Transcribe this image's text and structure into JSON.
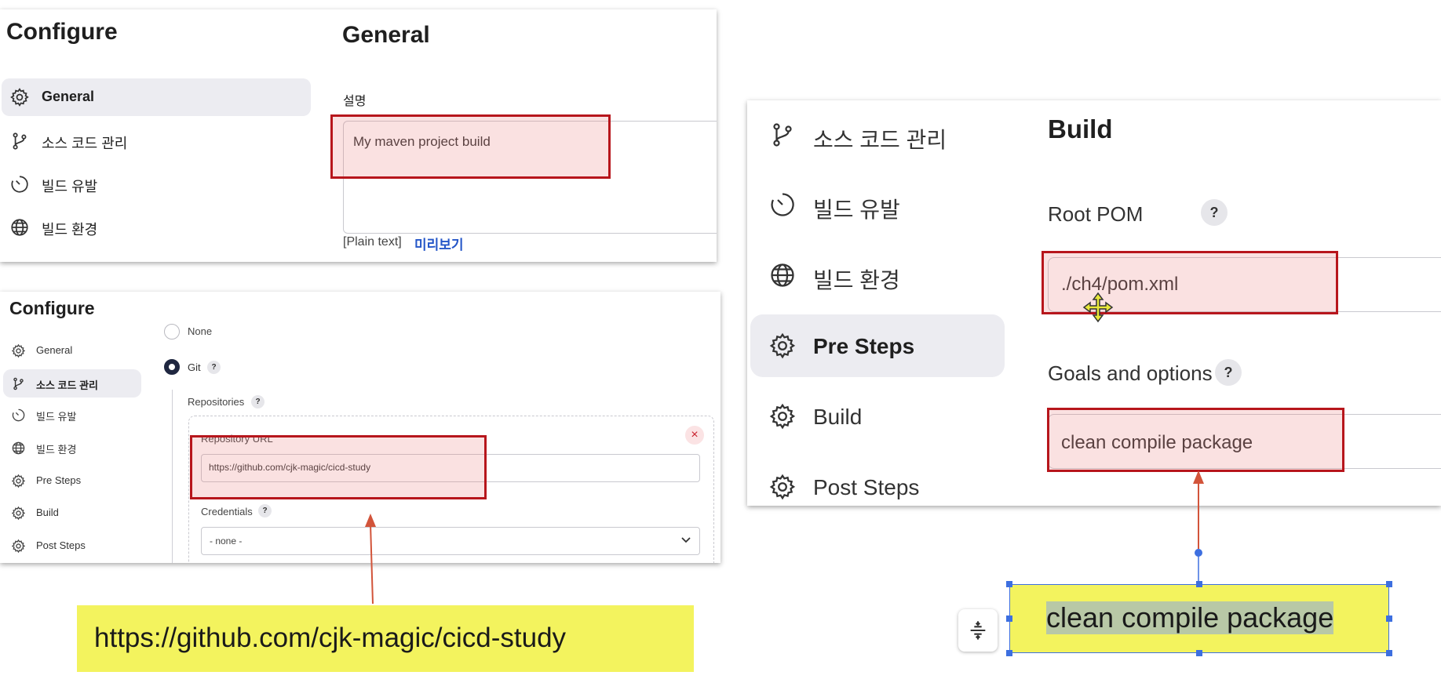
{
  "panel1": {
    "heading": "Configure",
    "section_title": "General",
    "nav": [
      {
        "label": "General",
        "icon": "gear-icon"
      },
      {
        "label": "소스 코드 관리",
        "icon": "git-branch-icon"
      },
      {
        "label": "빌드 유발",
        "icon": "clock-icon"
      },
      {
        "label": "빌드 환경",
        "icon": "globe-icon"
      }
    ],
    "description_label": "설명",
    "description_value": "My maven project build",
    "plain_text": "[Plain text]",
    "preview_link": "미리보기"
  },
  "panel2": {
    "heading": "Configure",
    "nav": [
      {
        "label": "General",
        "icon": "gear-icon"
      },
      {
        "label": "소스 코드 관리",
        "icon": "git-branch-icon"
      },
      {
        "label": "빌드 유발",
        "icon": "clock-icon"
      },
      {
        "label": "빌드 환경",
        "icon": "globe-icon"
      },
      {
        "label": "Pre Steps",
        "icon": "gear-icon"
      },
      {
        "label": "Build",
        "icon": "gear-icon"
      },
      {
        "label": "Post Steps",
        "icon": "gear-icon"
      }
    ],
    "radio_none": "None",
    "radio_git": "Git",
    "help": "?",
    "repositories_label": "Repositories",
    "repository_url_label": "Repository URL",
    "repository_url_value": "https://github.com/cjk-magic/cicd-study",
    "credentials_label": "Credentials",
    "credentials_value": "- none -",
    "remove_glyph": "×"
  },
  "panel3": {
    "nav": [
      {
        "label": "소스 코드 관리",
        "icon": "git-branch-icon"
      },
      {
        "label": "빌드 유발",
        "icon": "clock-icon"
      },
      {
        "label": "빌드 환경",
        "icon": "globe-icon"
      },
      {
        "label": "Pre Steps",
        "icon": "gear-icon"
      },
      {
        "label": "Build",
        "icon": "gear-icon"
      },
      {
        "label": "Post Steps",
        "icon": "gear-icon"
      }
    ],
    "section_title": "Build",
    "root_pom_label": "Root POM",
    "root_pom_value": "./ch4/pom.xml",
    "goals_label": "Goals and options",
    "goals_value": "clean compile package",
    "help": "?"
  },
  "callouts": {
    "url": "https://github.com/cjk-magic/cicd-study",
    "goals": "clean compile package"
  },
  "colors": {
    "highlight_border": "#b7161c",
    "callout_fill": "#f3f35e",
    "selection_handle": "#3d6fe0",
    "nav_active_bg": "#ececf1",
    "link": "#2456c8"
  }
}
